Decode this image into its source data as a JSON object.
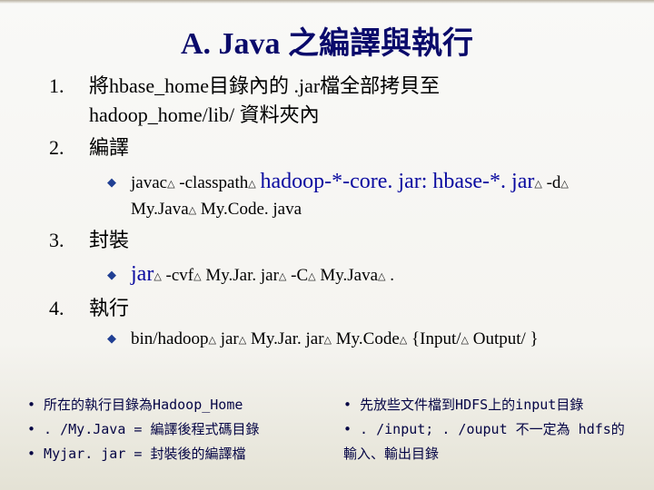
{
  "title": "A. Java 之編譯與執行",
  "items": {
    "n1": "1.",
    "t1a": "將hbase_home目錄內的 .jar檔全部拷貝至",
    "t1b": "hadoop_home/lib/ 資料夾內",
    "n2": "2.",
    "t2": "編譯",
    "s2a": "javac",
    "s2b": "-classpath",
    "s2c": "hadoop-*-core. jar: hbase-*. jar",
    "s2d": "-d",
    "s2e": "My.Java",
    "s2f": "My.Code. java",
    "n3": "3.",
    "t3": "封裝",
    "s3a": "jar",
    "s3b": "-cvf",
    "s3c": "My.Jar. jar",
    "s3d": "-C",
    "s3e": "My.Java",
    "s3f": ".",
    "n4": "4.",
    "t4": "執行",
    "s4a": "bin/hadoop",
    "s4b": "jar",
    "s4c": "My.Jar. jar",
    "s4d": "My.Code",
    "s4e": "{Input/",
    "s4f": "Output/ }"
  },
  "footer": {
    "l1": "• 所在的執行目錄為Hadoop_Home",
    "l2": "• . /My.Java = 編譯後程式碼目錄",
    "l3": "• Myjar. jar = 封裝後的編譯檔",
    "r1": "• 先放些文件檔到HDFS上的input目錄",
    "r2": "• . /input; . /ouput 不一定為 hdfs的輸入、輸出目錄"
  },
  "glyph": {
    "tri": "△",
    "diamond": "◆"
  }
}
